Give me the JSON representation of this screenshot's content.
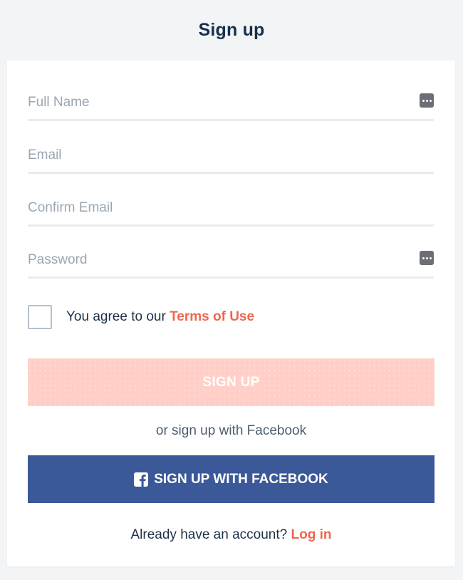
{
  "page": {
    "title": "Sign up"
  },
  "form": {
    "full_name": {
      "placeholder": "Full Name",
      "value": "",
      "icon": "password-manager-icon"
    },
    "email": {
      "placeholder": "Email",
      "value": ""
    },
    "confirm_email": {
      "placeholder": "Confirm Email",
      "value": ""
    },
    "password": {
      "placeholder": "Password",
      "value": "",
      "icon": "password-manager-icon"
    },
    "terms": {
      "checked": false,
      "prefix": "You agree to our ",
      "link_label": "Terms of Use"
    },
    "submit_label": "SIGN UP"
  },
  "divider_text": "or sign up with Facebook",
  "facebook": {
    "label": "SIGN UP WITH FACEBOOK",
    "icon": "facebook-icon"
  },
  "login": {
    "prompt": "Already have an account? ",
    "link_label": "Log in"
  },
  "colors": {
    "background": "#f3f4f6",
    "title": "#16304b",
    "accent": "#f0664c",
    "submit_disabled": "#ffcfc7",
    "facebook": "#3b5998",
    "field_border": "#e9ecef",
    "placeholder": "#9aa6b3"
  }
}
